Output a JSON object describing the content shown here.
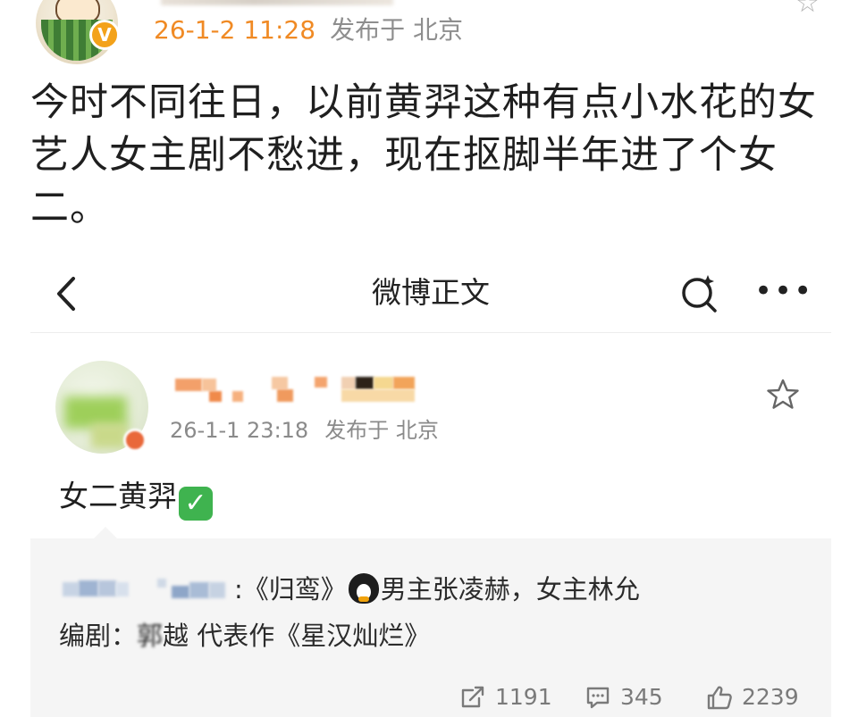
{
  "outer_post": {
    "avatar_icon": "watermelon-cartoon-avatar",
    "verified_badge": "V",
    "timestamp": "26-1-2 11:28",
    "location": "发布于 北京",
    "body": "今时不同往日，以前黄羿这种有点小水花的女艺人女主剧不愁进，现在抠脚半年进了个女二。"
  },
  "embedded_screenshot": {
    "nav": {
      "back_icon": "chevron-left-icon",
      "title": "微博正文",
      "search_icon": "search-icon",
      "more_icon": "more-icon",
      "more_glyph": "•••"
    },
    "post": {
      "timestamp": "26-1-1 23:18",
      "location": "发布于 北京",
      "text": "女二黄羿",
      "check_emoji": "✓"
    },
    "repost": {
      "line1_prefix_tail": ":《归鸾》",
      "line1_rest": "男主张凌赫，女主林允",
      "line2_label": "编剧：",
      "line2_blurred": "郭",
      "line2_rest": "越 代表作《星汉灿烂》"
    },
    "actions": {
      "repost_count": "1191",
      "comment_count": "345",
      "like_count": "2239"
    }
  }
}
